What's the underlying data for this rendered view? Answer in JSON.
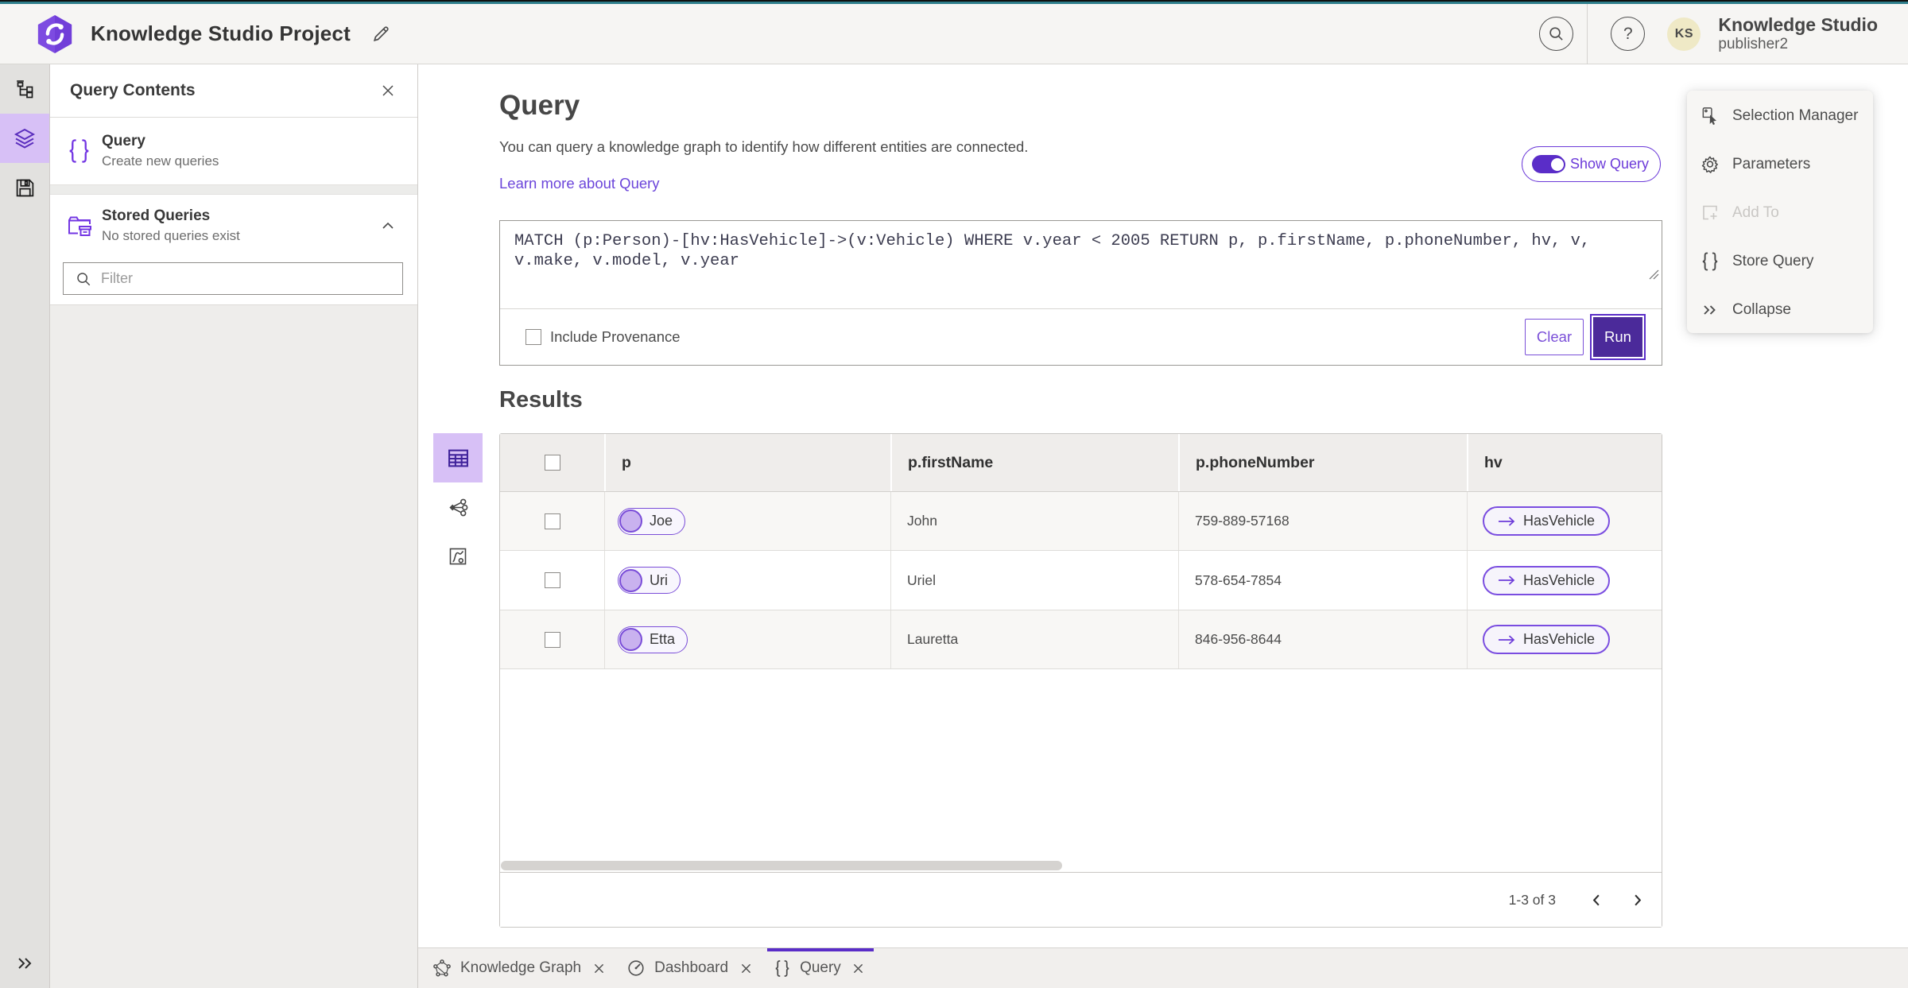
{
  "colors": {
    "accent": "#6c3bd9",
    "accent_deep": "#4b2a9a",
    "accent_bright": "#5a2dc8",
    "selected_bg": "#d7c0f6",
    "teal_strip": "#2e7e8b"
  },
  "header": {
    "title": "Knowledge Studio Project",
    "user": {
      "initials": "KS",
      "name": "Knowledge Studio",
      "role": "publisher2"
    }
  },
  "sidebar": {
    "title": "Query Contents",
    "query_item": {
      "title": "Query",
      "subtitle": "Create new queries"
    },
    "stored_item": {
      "title": "Stored Queries",
      "subtitle": "No stored queries exist"
    },
    "filter_placeholder": "Filter"
  },
  "main": {
    "heading": "Query",
    "description": "You can query a knowledge graph to identify how different entities are connected.",
    "learn_more": "Learn more about Query",
    "show_query_label": "Show Query",
    "query_text": "MATCH (p:Person)-[hv:HasVehicle]->(v:Vehicle) WHERE v.year < 2005 RETURN p, p.firstName, p.phoneNumber, hv, v, v.make, v.model, v.year",
    "include_provenance_label": "Include Provenance",
    "clear_label": "Clear",
    "run_label": "Run",
    "results_heading": "Results"
  },
  "results": {
    "columns": [
      "p",
      "p.firstName",
      "p.phoneNumber",
      "hv"
    ],
    "rows": [
      {
        "p": "Joe",
        "firstName": "John",
        "phone": "759-889-57168",
        "hv": "HasVehicle"
      },
      {
        "p": "Uri",
        "firstName": "Uriel",
        "phone": "578-654-7854",
        "hv": "HasVehicle"
      },
      {
        "p": "Etta",
        "firstName": "Lauretta",
        "phone": "846-956-8644",
        "hv": "HasVehicle"
      }
    ],
    "pagination": "1-3 of 3"
  },
  "tools_panel": {
    "items": [
      {
        "label": "Selection Manager",
        "disabled": false
      },
      {
        "label": "Parameters",
        "disabled": false
      },
      {
        "label": "Add To",
        "disabled": true
      },
      {
        "label": "Store Query",
        "disabled": false
      },
      {
        "label": "Collapse",
        "disabled": false
      }
    ]
  },
  "tabs": [
    {
      "label": "Knowledge Graph",
      "active": false
    },
    {
      "label": "Dashboard",
      "active": false
    },
    {
      "label": "Query",
      "active": true
    }
  ]
}
